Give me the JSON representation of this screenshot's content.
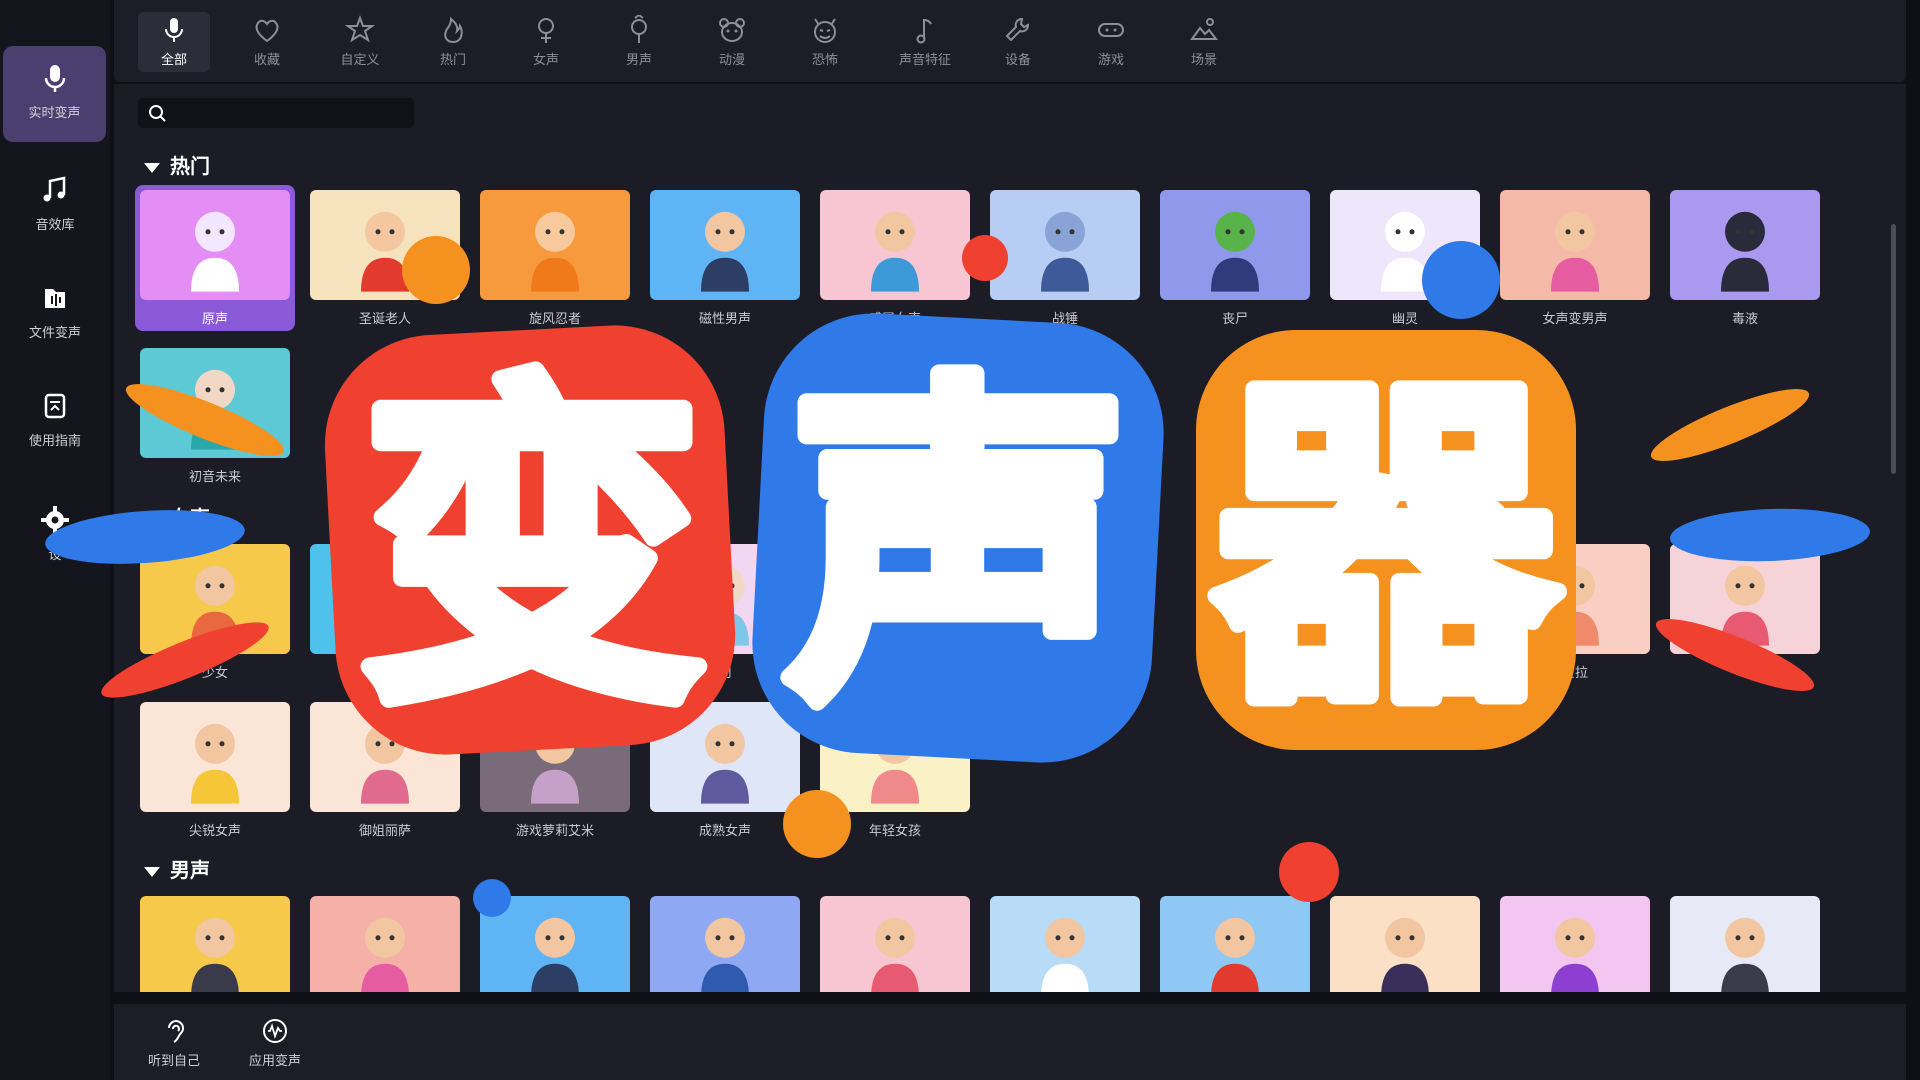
{
  "sidebar": {
    "items": [
      {
        "label": "实时变声",
        "icon": "microphone-icon",
        "active": true
      },
      {
        "label": "音效库",
        "icon": "music-note-icon"
      },
      {
        "label": "文件变声",
        "icon": "file-audio-icon"
      },
      {
        "label": "使用指南",
        "icon": "guide-icon"
      },
      {
        "label": "设",
        "icon": "gear-icon"
      }
    ]
  },
  "categories": [
    {
      "label": "全部",
      "icon": "microphone-icon",
      "active": true
    },
    {
      "label": "收藏",
      "icon": "heart-icon"
    },
    {
      "label": "自定义",
      "icon": "star-edit-icon"
    },
    {
      "label": "热门",
      "icon": "fire-icon"
    },
    {
      "label": "女声",
      "icon": "female-icon"
    },
    {
      "label": "男声",
      "icon": "male-icon"
    },
    {
      "label": "动漫",
      "icon": "bear-icon"
    },
    {
      "label": "恐怖",
      "icon": "devil-icon"
    },
    {
      "label": "声音特征",
      "icon": "music-note-icon"
    },
    {
      "label": "设备",
      "icon": "wrench-icon"
    },
    {
      "label": "游戏",
      "icon": "gamepad-icon"
    },
    {
      "label": "场景",
      "icon": "landscape-icon"
    }
  ],
  "search": {
    "placeholder": ""
  },
  "sections": {
    "hot": {
      "title": "热门",
      "cards": [
        {
          "label": "原声",
          "bg": "#e48df5",
          "skin": "#f3e6ff",
          "body": "#ffffff"
        },
        {
          "label": "圣诞老人",
          "bg": "#f6e3bd",
          "skin": "#f4c7a1",
          "body": "#e23a2e"
        },
        {
          "label": "旋风忍者",
          "bg": "#f7993d",
          "skin": "#f7c99c",
          "body": "#f07a1a"
        },
        {
          "label": "磁性男声",
          "bg": "#5fb4f5",
          "skin": "#f1c6a0",
          "body": "#2c3e63"
        },
        {
          "label": "感冒女声",
          "bg": "#f7c6d2",
          "skin": "#f1c6a0",
          "body": "#3d9ad8"
        },
        {
          "label": "战锤",
          "bg": "#b8cdf4",
          "skin": "#8aa3d6",
          "body": "#3e5a99"
        },
        {
          "label": "丧尸",
          "bg": "#9098ec",
          "skin": "#58b34a",
          "body": "#2f3c7c"
        },
        {
          "label": "幽灵",
          "bg": "#eee6fb",
          "skin": "#ffffff",
          "body": "#ffffff"
        },
        {
          "label": "女声变男声",
          "bg": "#f5b9a8",
          "skin": "#f1c6a0",
          "body": "#e55ca0"
        },
        {
          "label": "毒液",
          "bg": "#a99af0",
          "skin": "#2a2a3a",
          "body": "#2a2a3a"
        },
        {
          "label": "初音未来",
          "bg": "#5cc9d5",
          "skin": "#f1d8c6",
          "body": "#2aa7a7"
        }
      ]
    },
    "female": {
      "title": "女声",
      "cards": [
        {
          "label": "少女",
          "bg": "#f6c94a",
          "skin": "#f1c6a0",
          "body": "#e8693f"
        },
        {
          "label": "",
          "bg": "#4fc2ec",
          "skin": "#ffffff",
          "body": "#ffffff"
        },
        {
          "label": "利",
          "bg": "#f3d6f2",
          "skin": "#f1d8c6",
          "body": "#7fc7e8"
        },
        {
          "label": "贝拉",
          "bg": "#f8cfc2",
          "skin": "#f1c6a0",
          "body": "#ef8a6a"
        },
        {
          "label": "",
          "bg": "#f6d3d8",
          "skin": "#f1c6a0",
          "body": "#e85a72"
        },
        {
          "label": "尖锐女声",
          "bg": "#fbe5d6",
          "skin": "#f1c6a0",
          "body": "#f5c637"
        },
        {
          "label": "御姐丽萨",
          "bg": "#fbe5d6",
          "skin": "#f1c6a0",
          "body": "#e06b8e"
        },
        {
          "label": "游戏萝莉艾米",
          "bg": "#7a6b7a",
          "skin": "#f1c6a0",
          "body": "#c6a1c7"
        },
        {
          "label": "成熟女声",
          "bg": "#dfe6f8",
          "skin": "#f1c6a0",
          "body": "#5d5a9d"
        },
        {
          "label": "年轻女孩",
          "bg": "#fbf1c6",
          "skin": "#f1c6a0",
          "body": "#f08a8a"
        }
      ]
    },
    "male": {
      "title": "男声",
      "cards": [
        {
          "label": "",
          "bg": "#f6c94a",
          "skin": "#f1c6a0",
          "body": "#3a3a4a"
        },
        {
          "label": "",
          "bg": "#f5b1a8",
          "skin": "#f1c6a0",
          "body": "#e55ca0"
        },
        {
          "label": "",
          "bg": "#5fb4f5",
          "skin": "#f1c6a0",
          "body": "#2c3e63"
        },
        {
          "label": "",
          "bg": "#8ea8f3",
          "skin": "#f1c6a0",
          "body": "#2f5ab0"
        },
        {
          "label": "",
          "bg": "#f7c6d2",
          "skin": "#f1c6a0",
          "body": "#e85a72"
        },
        {
          "label": "",
          "bg": "#b8dcf7",
          "skin": "#f1c6a0",
          "body": "#ffffff"
        },
        {
          "label": "",
          "bg": "#8fc7f5",
          "skin": "#f1c6a0",
          "body": "#e23a2e"
        },
        {
          "label": "",
          "bg": "#fbe0c6",
          "skin": "#f1c6a0",
          "body": "#3a2f5a"
        },
        {
          "label": "",
          "bg": "#f3c6f2",
          "skin": "#f1c6a0",
          "body": "#8c3fd0"
        },
        {
          "label": "",
          "bg": "#e8e9f7",
          "skin": "#f1c6a0",
          "body": "#3a3a4a"
        }
      ]
    }
  },
  "bottom": {
    "listen_label": "听到自己",
    "apply_label": "应用变声"
  },
  "overlay_title": {
    "chars": [
      "变",
      "声",
      "器"
    ],
    "colors": [
      "#f0402f",
      "#2f7ae8",
      "#f5921f"
    ]
  }
}
